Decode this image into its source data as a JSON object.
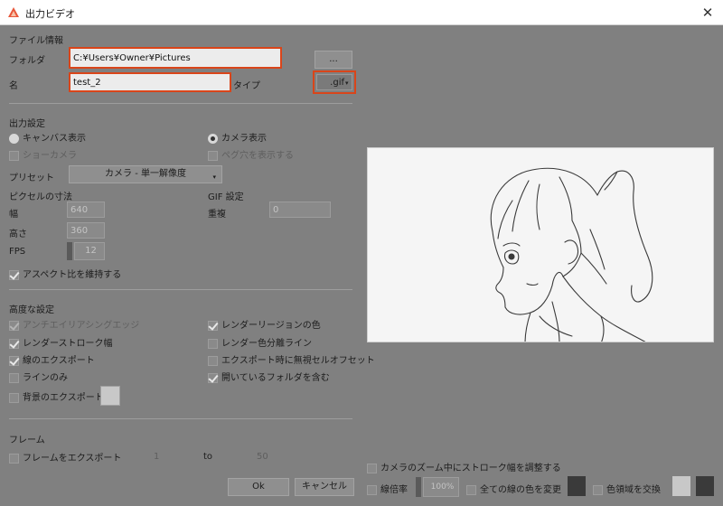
{
  "window": {
    "title": "出力ビデオ",
    "close_glyph": "✕",
    "icon": "app-logo-icon"
  },
  "file_info": {
    "section": "ファイル情報",
    "folder_label": "フォルダ",
    "folder_value": "C:¥Users¥Owner¥Pictures",
    "browse_label": "...",
    "name_label": "名",
    "name_value": "test_2",
    "type_label": "タイプ",
    "type_value": ".gif"
  },
  "output": {
    "section": "出力設定",
    "canvas_view": "キャンバス表示",
    "camera_view": "カメラ表示",
    "selected_view": "camera",
    "show_camera": "ショーカメラ",
    "show_peg_holes": "ペグ穴を表示する",
    "preset_label": "プリセット",
    "preset_value": "カメラ - 単一解像度",
    "pixel_dims_label": "ピクセルの寸法",
    "width_label": "幅",
    "width_value": "640",
    "height_label": "高さ",
    "height_value": "360",
    "fps_label": "FPS",
    "fps_value": "12",
    "aspect_label": "アスペクト比を維持する",
    "gif_settings_label": "GIF 設定",
    "dither_label": "重複",
    "dither_value": "0"
  },
  "advanced": {
    "section": "高度な設定",
    "left": [
      {
        "label": "アンチエイリアシングエッジ",
        "checked": true,
        "disabled": true
      },
      {
        "label": "レンダーストローク幅",
        "checked": true,
        "disabled": false
      },
      {
        "label": "線のエクスポート",
        "checked": true,
        "disabled": false
      },
      {
        "label": "ラインのみ",
        "checked": false,
        "disabled": false
      },
      {
        "label": "背景のエクスポート",
        "checked": false,
        "disabled": false
      }
    ],
    "right": [
      {
        "label": "レンダーリージョンの色",
        "checked": true
      },
      {
        "label": "レンダー色分離ライン",
        "checked": false
      },
      {
        "label": "エクスポート時に無視セルオフセット",
        "checked": false
      },
      {
        "label": "開いているフォルダを含む",
        "checked": true
      }
    ],
    "bg_color": "#c8c8c8"
  },
  "frames": {
    "section": "フレーム",
    "export_frames_label": "フレームをエクスポート",
    "from_value": "1",
    "to_label": "to",
    "to_value": "50"
  },
  "preview_options": {
    "adjust_stroke_label": "カメラのズーム中にストローク幅を調整する",
    "line_scale_label": "線倍率",
    "line_scale_value": "100%",
    "change_all_colors_label": "全ての線の色を変更",
    "swap_colors_label": "色領域を交換",
    "line_color": "#3a3a3a",
    "swap_color_a": "#c8c8c8",
    "swap_color_b": "#3a3a3a"
  },
  "footer": {
    "ok_label": "Ok",
    "cancel_label": "キャンセル"
  },
  "colors": {
    "dialog_bg": "#808080",
    "highlight": "#d9451a",
    "preview_bg": "#f5f5f5"
  }
}
